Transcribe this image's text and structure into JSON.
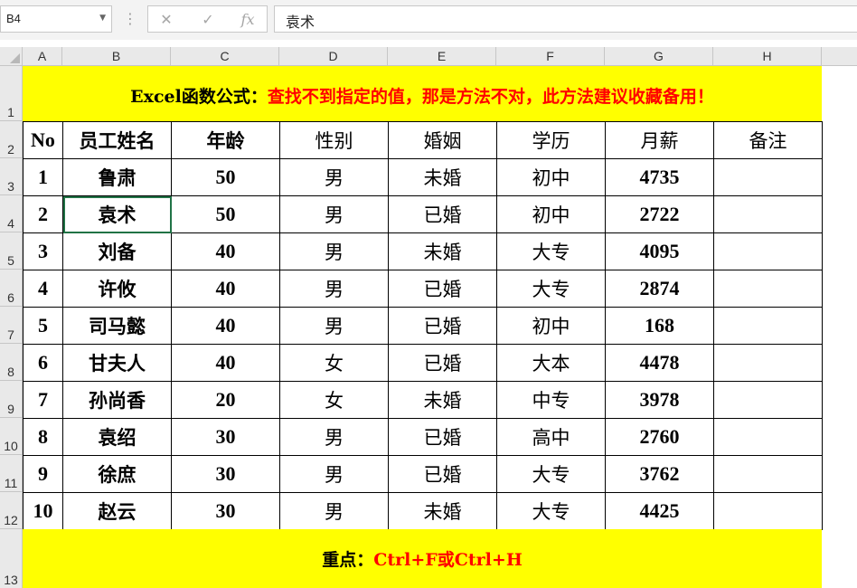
{
  "formula_bar": {
    "name_box": "B4",
    "cancel_icon": "✕",
    "enter_icon": "✓",
    "fx_icon": "fx",
    "formula": "袁术"
  },
  "columns": [
    "A",
    "B",
    "C",
    "D",
    "E",
    "F",
    "G",
    "H"
  ],
  "rows": [
    "1",
    "2",
    "3",
    "4",
    "5",
    "6",
    "7",
    "8",
    "9",
    "10",
    "11",
    "12",
    "13"
  ],
  "title": {
    "prefix": "Excel函数公式：",
    "text": "查找不到指定的值，那是方法不对，此方法建议收藏备用！"
  },
  "table": {
    "headers": [
      "No",
      "员工姓名",
      "年龄",
      "性别",
      "婚姻",
      "学历",
      "月薪",
      "备注"
    ],
    "rows": [
      [
        "1",
        "鲁肃",
        "50",
        "男",
        "未婚",
        "初中",
        "4735",
        ""
      ],
      [
        "2",
        "袁术",
        "50",
        "男",
        "已婚",
        "初中",
        "2722",
        ""
      ],
      [
        "3",
        "刘备",
        "40",
        "男",
        "未婚",
        "大专",
        "4095",
        ""
      ],
      [
        "4",
        "许攸",
        "40",
        "男",
        "已婚",
        "大专",
        "2874",
        ""
      ],
      [
        "5",
        "司马懿",
        "40",
        "男",
        "已婚",
        "初中",
        "168",
        ""
      ],
      [
        "6",
        "甘夫人",
        "40",
        "女",
        "已婚",
        "大本",
        "4478",
        ""
      ],
      [
        "7",
        "孙尚香",
        "20",
        "女",
        "未婚",
        "中专",
        "3978",
        ""
      ],
      [
        "8",
        "袁绍",
        "30",
        "男",
        "已婚",
        "高中",
        "2760",
        ""
      ],
      [
        "9",
        "徐庶",
        "30",
        "男",
        "已婚",
        "大专",
        "3762",
        ""
      ],
      [
        "10",
        "赵云",
        "30",
        "男",
        "未婚",
        "大专",
        "4425",
        ""
      ]
    ]
  },
  "footer": {
    "prefix": "重点：",
    "text": "Ctrl+F或Ctrl+H"
  },
  "colors": {
    "highlight": "#ffff00",
    "accent_red": "#ff0000",
    "selection": "#217346"
  }
}
